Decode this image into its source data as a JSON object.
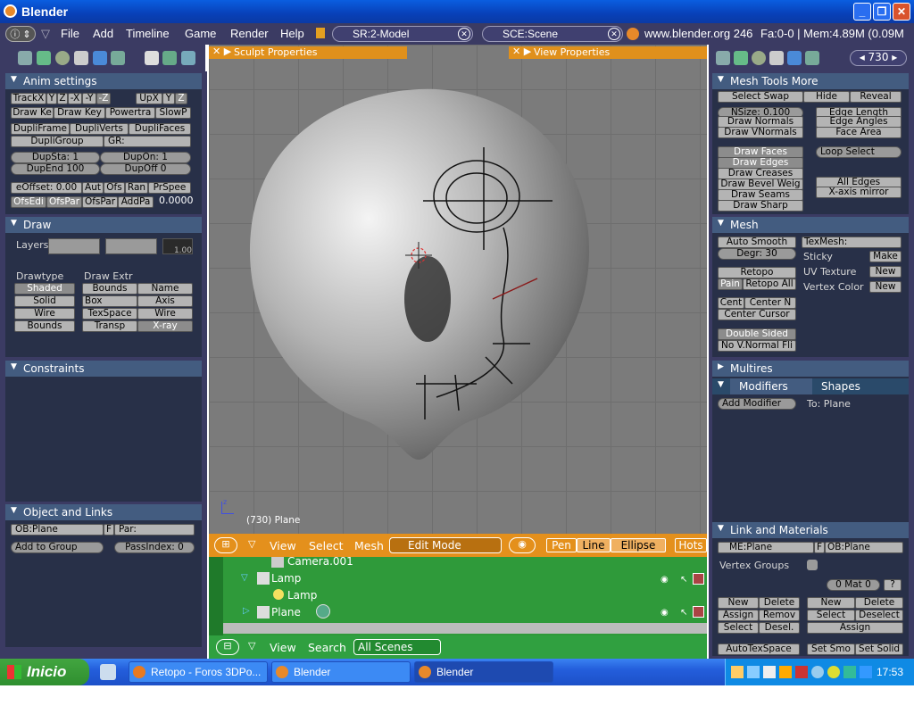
{
  "window": {
    "title": "Blender"
  },
  "menubar": {
    "items": [
      "File",
      "Add",
      "Timeline",
      "Game",
      "Render",
      "Help"
    ],
    "screen": "SR:2-Model",
    "scene": "SCE:Scene",
    "info": "www.blender.org 246",
    "stats": "Fa:0-0 | Mem:4.89M (0.09M"
  },
  "buttons_header": {
    "frame": "730"
  },
  "anim": {
    "title": "Anim settings",
    "row1": [
      "TrackX",
      "Y",
      "Z",
      "-X",
      "-Y",
      "-Z",
      "UpX",
      "Y",
      "Z"
    ],
    "row2": [
      "Draw Ke",
      "Draw Key",
      "Powertra",
      "SlowP"
    ],
    "row3": [
      "DupliFrame",
      "DupliVerts",
      "DupliFaces"
    ],
    "dupligroup": "DupliGroup",
    "gr": "GR:",
    "dupsta": "DupSta: 1",
    "dupon": "DupOn: 1",
    "dupend": "DupEnd 100",
    "dupoff": "DupOff 0",
    "eoffset": "eOffset: 0.00",
    "row6": [
      "Aut",
      "Ofs",
      "Ran",
      "PrSpee"
    ],
    "row7": [
      "OfsEdi",
      "OfsPar",
      "OfsPar",
      "AddPa"
    ],
    "value": "0.0000"
  },
  "draw": {
    "title": "Draw",
    "layers": "Layers",
    "layerval": "1.00",
    "drawtype": "Drawtype",
    "drawextr": "Draw Extr",
    "types": [
      "Shaded",
      "Solid",
      "Wire",
      "Bounds"
    ],
    "extr1": [
      "Bounds",
      "Box",
      "TexSpace",
      "Transp"
    ],
    "extr2": [
      "Name",
      "Axis",
      "Wire",
      "X-ray"
    ]
  },
  "constraints": {
    "title": "Constraints"
  },
  "objlinks": {
    "title": "Object and Links",
    "ob": "OB:Plane",
    "f": "F",
    "par": "Par:",
    "addgroup": "Add to Group",
    "passindex": "PassIndex: 0"
  },
  "sculpt_props": "Sculpt Properties",
  "view_props": "View Properties",
  "viewport": {
    "label": "(730) Plane",
    "axis": "z"
  },
  "v3d_header": {
    "items": [
      "View",
      "Select",
      "Mesh"
    ],
    "mode": "Edit Mode",
    "tools": [
      "Pen",
      "Line",
      "Ellipse",
      "Hots"
    ]
  },
  "outliner": {
    "rows": [
      "Camera.001",
      "Lamp",
      "Lamp",
      "Plane"
    ]
  },
  "out_header": {
    "items": [
      "View",
      "Search"
    ],
    "scope": "All Scenes"
  },
  "meshtools": {
    "title": "Mesh Tools More",
    "row1": [
      "Select Swap",
      "Hide",
      "Reveal"
    ],
    "nsize": "NSize: 0.100",
    "col1": [
      "Draw Normals",
      "Draw VNormals"
    ],
    "col2": [
      "Edge Length",
      "Edge Angles",
      "Face Area"
    ],
    "col3": [
      "Draw Faces",
      "Draw Edges",
      "Draw Creases",
      "Draw Bevel Weig",
      "Draw Seams",
      "Draw Sharp"
    ],
    "loop": "Loop Select",
    "alledges": "All Edges",
    "xmirror": "X-axis mirror"
  },
  "mesh": {
    "title": "Mesh",
    "autosmooth": "Auto Smooth",
    "degr": "Degr: 30",
    "texmesh": "TexMesh:",
    "sticky": "Sticky",
    "make": "Make",
    "uvtex": "UV Texture",
    "new": "New",
    "vcol": "Vertex Color",
    "retopo": "Retopo",
    "pain": "Pain",
    "retopoall": "Retopo All",
    "cent": "Cent",
    "centern": "Center N",
    "centercursor": "Center Cursor",
    "double": "Double Sided",
    "novnormal": "No V.Normal Fli"
  },
  "multires": {
    "title": "Multires"
  },
  "modifiers": {
    "tab1": "Modifiers",
    "tab2": "Shapes",
    "add": "Add Modifier",
    "to": "To: Plane"
  },
  "linkmat": {
    "title": "Link and Materials",
    "me": "ME:Plane",
    "f": "F",
    "ob": "OB:Plane",
    "vgroups": "Vertex Groups",
    "mat": "0 Mat 0",
    "q": "?",
    "left": [
      "New",
      "Delete",
      "Assign",
      "Remov",
      "Select",
      "Desel."
    ],
    "right": [
      "New",
      "Delete",
      "Select",
      "Deselect",
      "Assign"
    ],
    "auto": "AutoTexSpace",
    "setsmo": "Set Smo",
    "setsolid": "Set Solid"
  },
  "taskbar": {
    "start": "Inicio",
    "tasks": [
      "Retopo - Foros 3DPo...",
      "Blender",
      "Blender"
    ],
    "clock": "17:53"
  },
  "colors": {
    "panel": "#283048",
    "header": "#435c80",
    "orange": "#e4901c",
    "green": "#2f9a3a"
  }
}
